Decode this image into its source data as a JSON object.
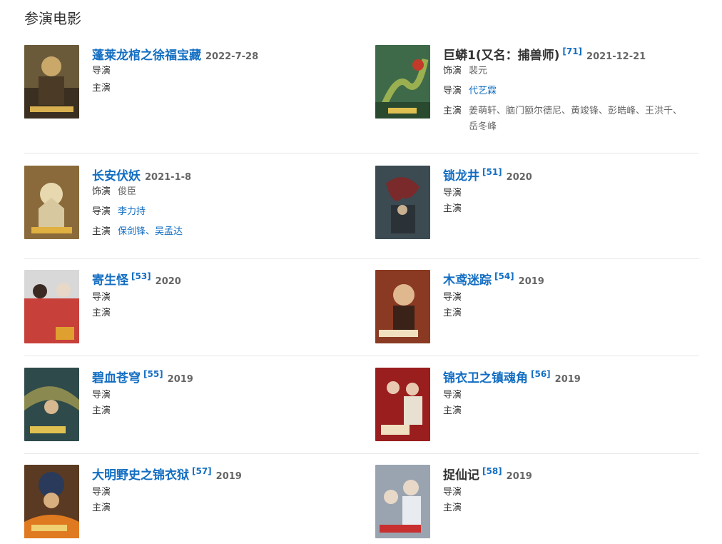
{
  "section": {
    "title": "参演电影"
  },
  "labels": {
    "role": "饰演",
    "director": "导演",
    "cast": "主演"
  },
  "films": [
    {
      "title": "蓬莱龙棺之徐福宝藏",
      "ref": "",
      "date": "2022-7-28",
      "title_link": true,
      "role": "",
      "director": "",
      "cast": ""
    },
    {
      "title": "巨蟒1(又名：捕兽师)",
      "ref": "[71]",
      "date": "2021-12-21",
      "title_link": false,
      "role": "裴元",
      "director": "代艺霖",
      "cast": "姜萌轩、脑门额尔德尼、黄竣锋、彭皓峰、王洪千、岳冬峰"
    },
    {
      "title": "长安伏妖",
      "ref": "",
      "date": "2021-1-8",
      "title_link": true,
      "role": "俊臣",
      "director": "李力持",
      "cast": "保剑锋、吴孟达"
    },
    {
      "title": "锁龙井",
      "ref": "[51]",
      "date": "2020",
      "title_link": true,
      "role": "",
      "director": "",
      "cast": ""
    },
    {
      "title": "寄生怪",
      "ref": "[53]",
      "date": "2020",
      "title_link": true,
      "role": "",
      "director": "",
      "cast": ""
    },
    {
      "title": "木鸢迷踪",
      "ref": "[54]",
      "date": "2019",
      "title_link": true,
      "role": "",
      "director": "",
      "cast": ""
    },
    {
      "title": "碧血苍穹",
      "ref": "[55]",
      "date": "2019",
      "title_link": true,
      "role": "",
      "director": "",
      "cast": ""
    },
    {
      "title": "锦衣卫之镇魂角",
      "ref": "[56]",
      "date": "2019",
      "title_link": true,
      "role": "",
      "director": "",
      "cast": ""
    },
    {
      "title": "大明野史之锦衣狱",
      "ref": "[57]",
      "date": "2019",
      "title_link": true,
      "role": "",
      "director": "",
      "cast": ""
    },
    {
      "title": "捉仙记",
      "ref": "[58]",
      "date": "2019",
      "title_link": false,
      "role": "",
      "director": "",
      "cast": ""
    }
  ],
  "poster_colors": [
    "#6b5a3a",
    "#3f6a4a",
    "#8a6a3a",
    "#3c4a52",
    "#c8403a",
    "#8a3a22",
    "#2f4a4a",
    "#9a1e1e",
    "#5a3a22",
    "#9aa4b0"
  ]
}
